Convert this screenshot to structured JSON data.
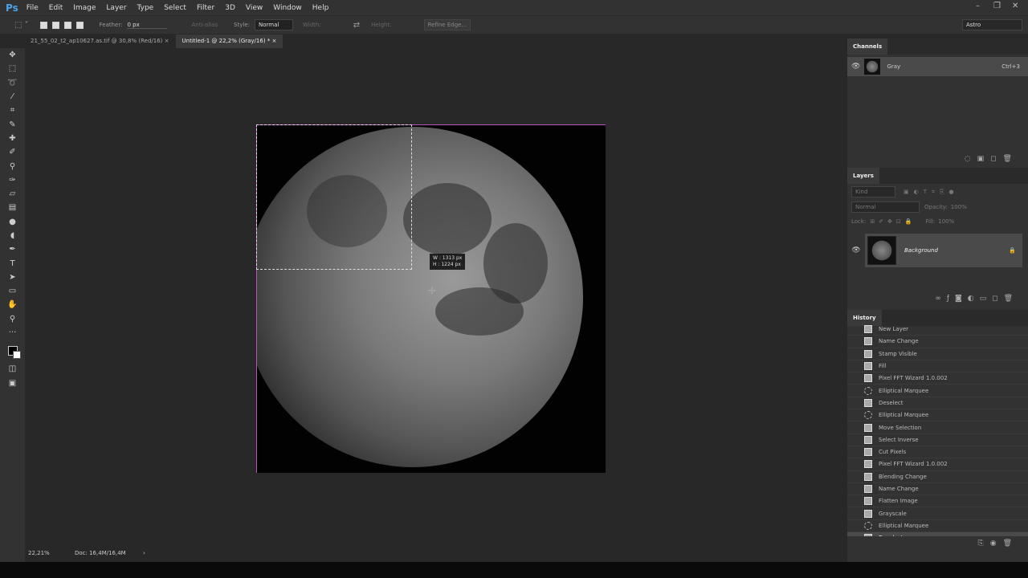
{
  "app": {
    "logo": "Ps",
    "menu": [
      "File",
      "Edit",
      "Image",
      "Layer",
      "Type",
      "Select",
      "Filter",
      "3D",
      "View",
      "Window",
      "Help"
    ]
  },
  "options": {
    "feather_label": "Feather:",
    "feather_value": "0 px",
    "antialias": "Anti-alias",
    "style_label": "Style:",
    "style_value": "Normal",
    "width_label": "Width:",
    "height_label": "Height:",
    "refine": "Refine Edge...",
    "workspace": "Astro"
  },
  "tabs": [
    {
      "label": "21_55_02_t2_ap10627.as.tif @ 30,8% (Red/16)",
      "close": "×"
    },
    {
      "label": "Untitled-1 @ 22,2% (Gray/16) *",
      "close": "×"
    }
  ],
  "tooltip": {
    "w": "W :  1313 px",
    "h": "H :  1224 px"
  },
  "status": {
    "zoom": "22,21%",
    "doc": "Doc: 16,4M/16,4M",
    "arrow": "›"
  },
  "channels": {
    "title": "Channels",
    "item": "Gray",
    "shortcut": "Ctrl+3"
  },
  "layers": {
    "title": "Layers",
    "kind": "Kind",
    "blend": "Normal",
    "opacity_label": "Opacity:",
    "opacity": "100%",
    "lock_label": "Lock:",
    "fill_label": "Fill:",
    "fill": "100%",
    "layer_name": "Background"
  },
  "history": {
    "title": "History",
    "items": [
      {
        "label": "New Layer",
        "icon": "doc"
      },
      {
        "label": "Name Change",
        "icon": "doc"
      },
      {
        "label": "Stamp Visible",
        "icon": "doc"
      },
      {
        "label": "Fill",
        "icon": "doc"
      },
      {
        "label": "Pixel FFT Wizard 1.0.002",
        "icon": "doc"
      },
      {
        "label": "Elliptical Marquee",
        "icon": "ellipse"
      },
      {
        "label": "Deselect",
        "icon": "doc"
      },
      {
        "label": "Elliptical Marquee",
        "icon": "ellipse"
      },
      {
        "label": "Move Selection",
        "icon": "doc"
      },
      {
        "label": "Select Inverse",
        "icon": "doc"
      },
      {
        "label": "Cut Pixels",
        "icon": "doc"
      },
      {
        "label": "Pixel FFT Wizard 1.0.002",
        "icon": "doc"
      },
      {
        "label": "Blending Change",
        "icon": "doc"
      },
      {
        "label": "Name Change",
        "icon": "doc"
      },
      {
        "label": "Flatten Image",
        "icon": "doc"
      },
      {
        "label": "Grayscale",
        "icon": "doc"
      },
      {
        "label": "Elliptical Marquee",
        "icon": "ellipse"
      },
      {
        "label": "Deselect",
        "icon": "doc",
        "selected": true
      }
    ]
  }
}
